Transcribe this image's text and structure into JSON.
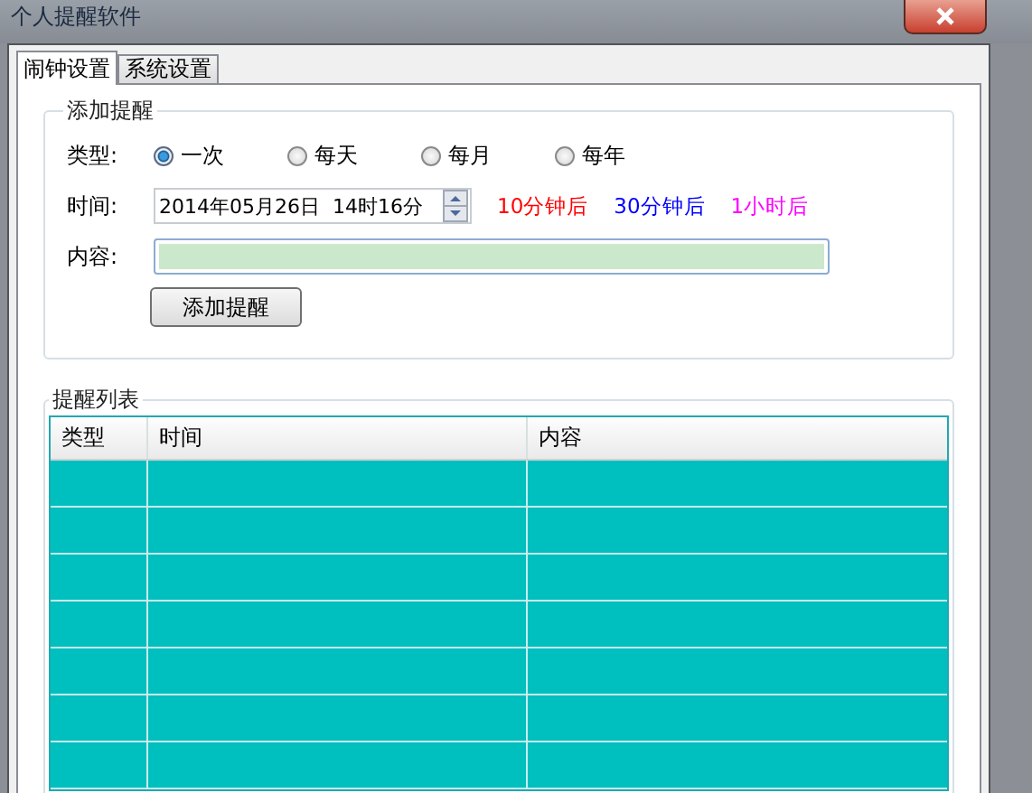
{
  "window": {
    "title": "个人提醒软件"
  },
  "tabs": [
    {
      "label": "闹钟设置",
      "selected": true
    },
    {
      "label": "系统设置",
      "selected": false
    }
  ],
  "add_group": {
    "title": "添加提醒",
    "type_label": "类型:",
    "types": [
      {
        "label": "一次",
        "selected": true
      },
      {
        "label": "每天",
        "selected": false
      },
      {
        "label": "每月",
        "selected": false
      },
      {
        "label": "每年",
        "selected": false
      }
    ],
    "time_label": "时间:",
    "time_value": "2014年05月26日  14时16分",
    "quick_links": [
      {
        "label": "10分钟后",
        "color": "#ff0000"
      },
      {
        "label": "30分钟后",
        "color": "#0000ff"
      },
      {
        "label": "1小时后",
        "color": "#ff00ff"
      }
    ],
    "content_label": "内容:",
    "add_button": "添加提醒"
  },
  "list_group": {
    "title": "提醒列表",
    "columns": [
      "类型",
      "时间",
      "内容"
    ]
  }
}
